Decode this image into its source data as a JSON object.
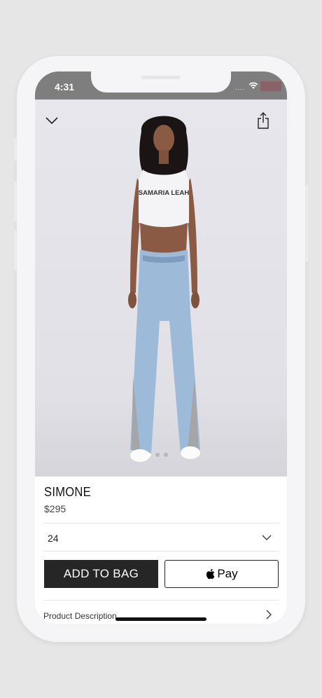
{
  "status_bar": {
    "time": "4:31",
    "signal_dots": "....",
    "wifi_icon": "wifi-icon",
    "battery_icon": "battery-icon"
  },
  "nav": {
    "close_icon": "chevron-down-icon",
    "share_icon": "share-icon"
  },
  "hero": {
    "shirt_print": "SAMARIA LEAH",
    "carousel_pages": 3,
    "carousel_active": 1
  },
  "product": {
    "name": "SIMONE",
    "price": "$295"
  },
  "size_selector": {
    "selected": "24"
  },
  "actions": {
    "add_to_bag": "ADD TO BAG",
    "apple_pay": "Pay"
  },
  "description": {
    "label": "Product Description"
  }
}
